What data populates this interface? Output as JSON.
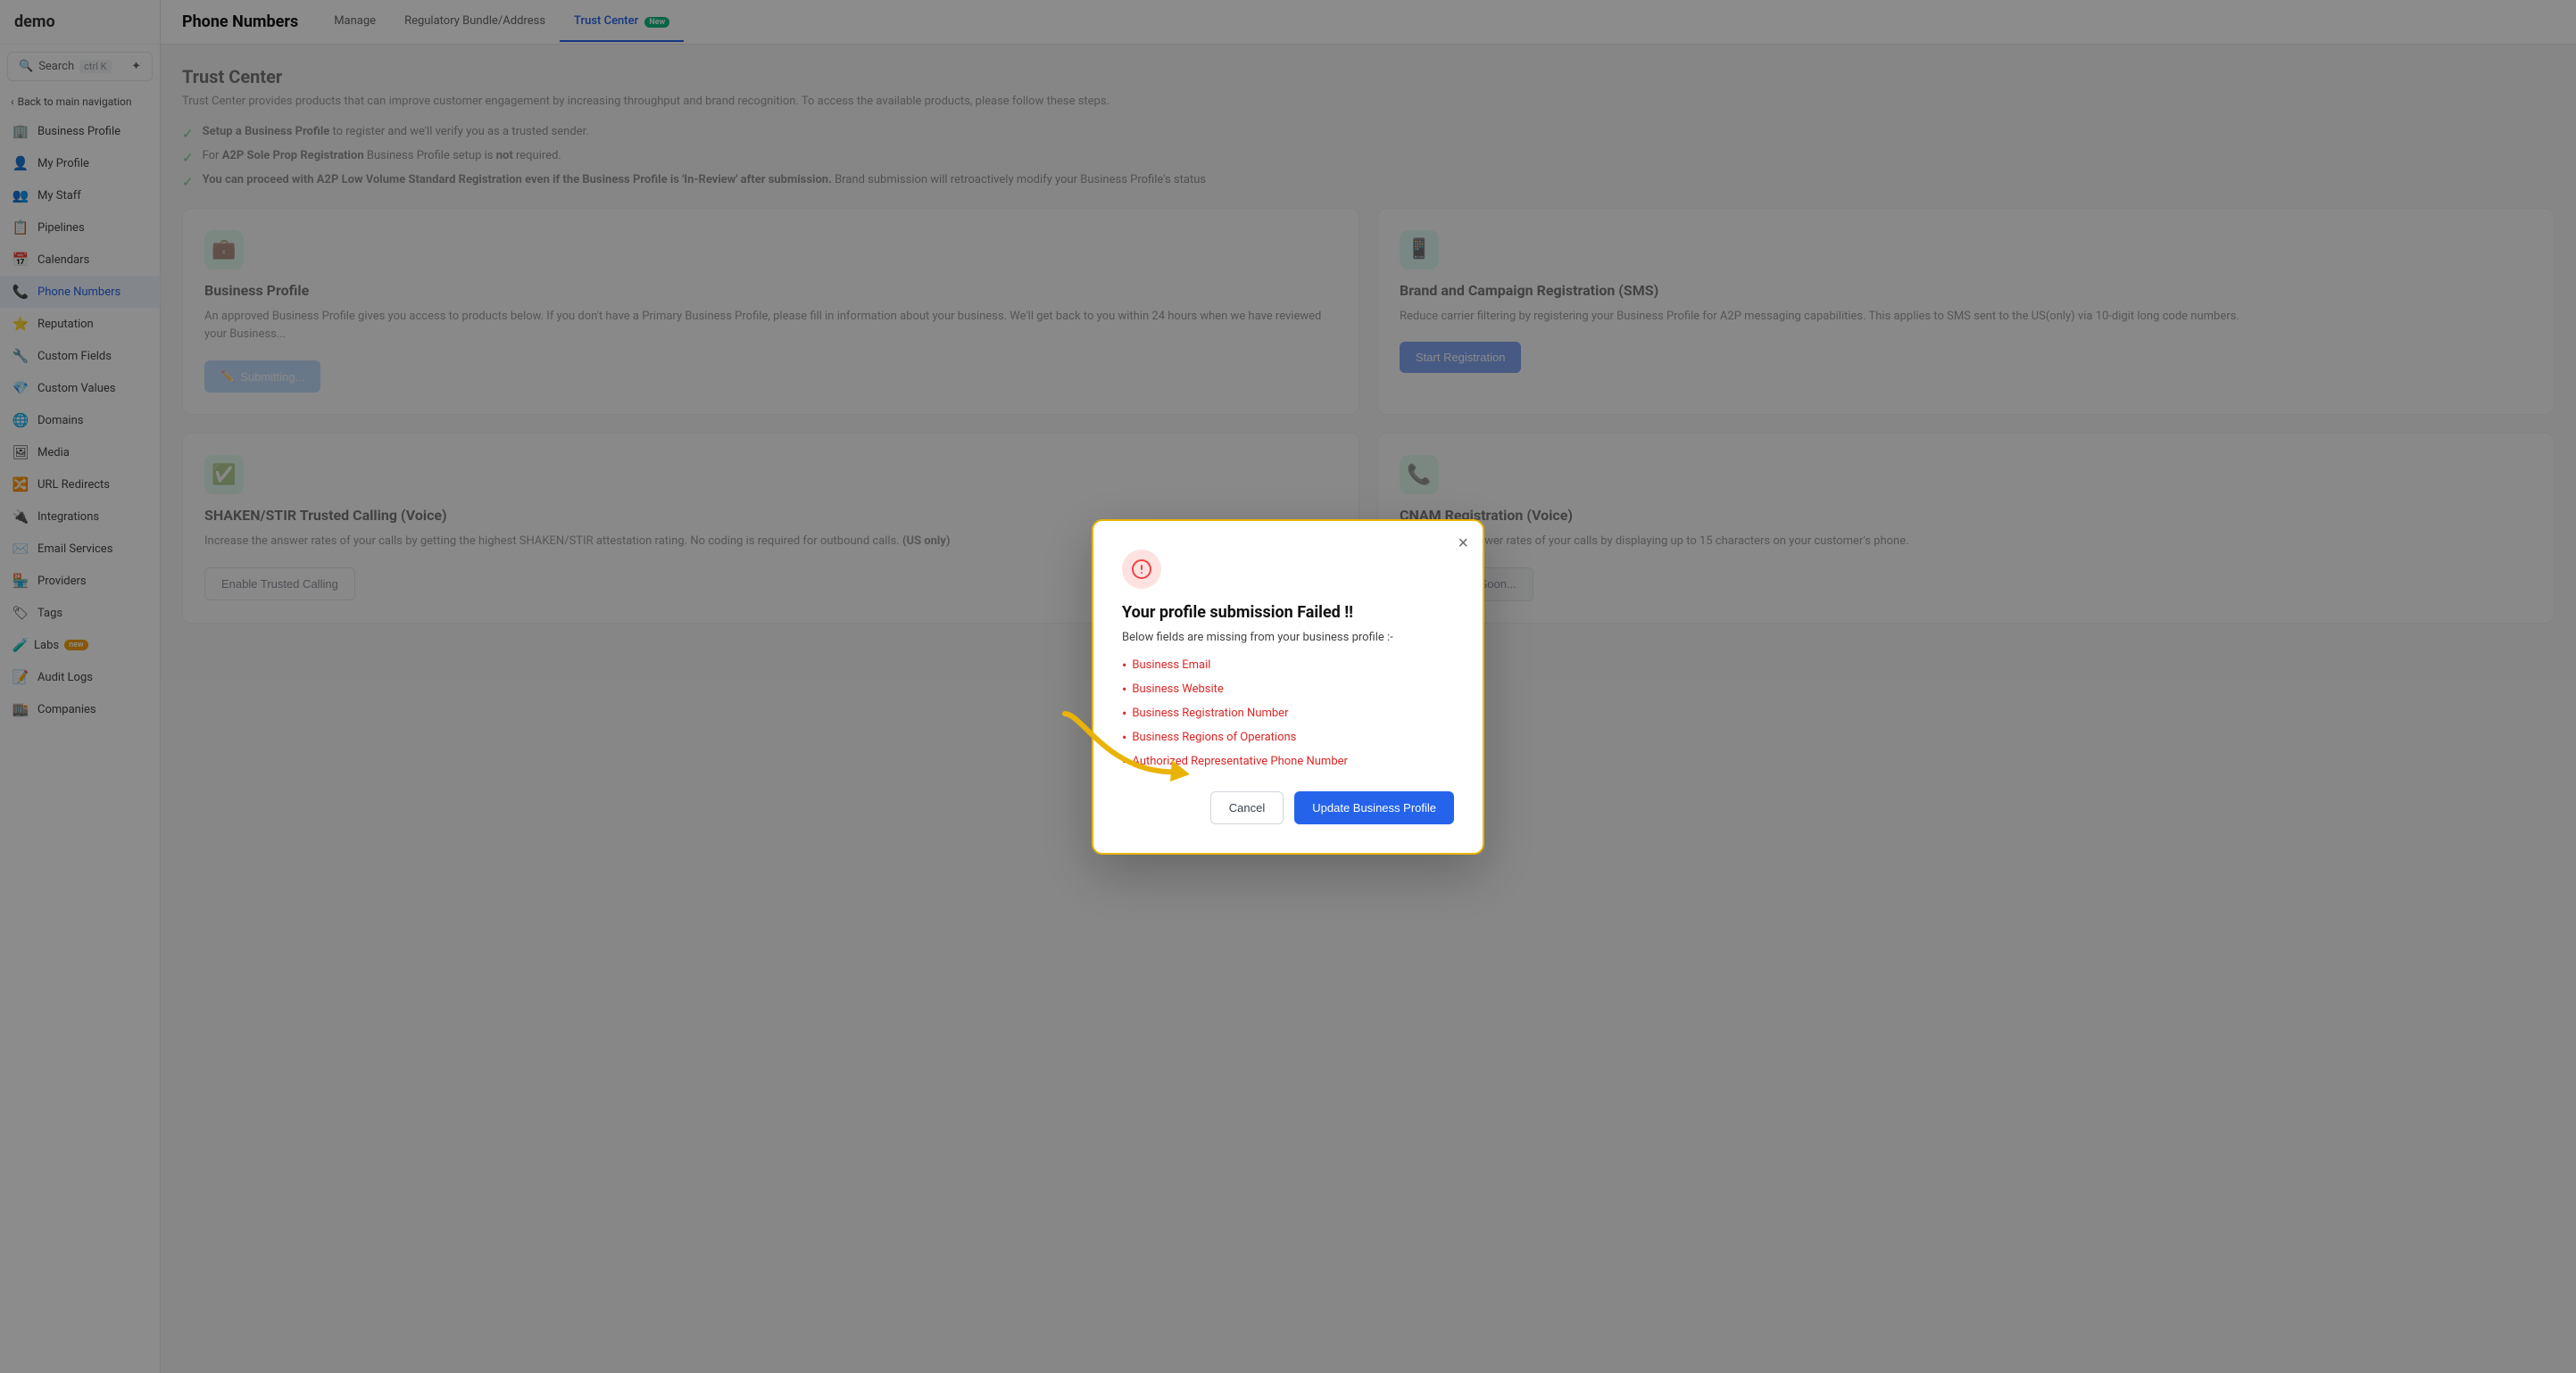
{
  "app": {
    "logo": "demo",
    "search_label": "Search",
    "search_kbd": "ctrl K"
  },
  "sidebar": {
    "back_label": "Back to main navigation",
    "items": [
      {
        "id": "business-profile",
        "label": "Business Profile",
        "icon": "🏢",
        "active": false
      },
      {
        "id": "my-profile",
        "label": "My Profile",
        "icon": "👤",
        "active": false
      },
      {
        "id": "my-staff",
        "label": "My Staff",
        "icon": "👥",
        "active": false
      },
      {
        "id": "pipelines",
        "label": "Pipelines",
        "icon": "📋",
        "active": false
      },
      {
        "id": "calendars",
        "label": "Calendars",
        "icon": "📅",
        "active": false
      },
      {
        "id": "phone-numbers",
        "label": "Phone Numbers",
        "icon": "📞",
        "active": true
      },
      {
        "id": "reputation",
        "label": "Reputation",
        "icon": "⭐",
        "active": false
      },
      {
        "id": "custom-fields",
        "label": "Custom Fields",
        "icon": "🔧",
        "active": false
      },
      {
        "id": "custom-values",
        "label": "Custom Values",
        "icon": "💎",
        "active": false
      },
      {
        "id": "domains",
        "label": "Domains",
        "icon": "🌐",
        "active": false
      },
      {
        "id": "media",
        "label": "Media",
        "icon": "🖼",
        "active": false
      },
      {
        "id": "url-redirects",
        "label": "URL Redirects",
        "icon": "🔀",
        "active": false
      },
      {
        "id": "integrations",
        "label": "Integrations",
        "icon": "🔌",
        "active": false
      },
      {
        "id": "email-services",
        "label": "Email Services",
        "icon": "✉️",
        "active": false
      },
      {
        "id": "providers",
        "label": "Providers",
        "icon": "🏪",
        "active": false
      },
      {
        "id": "tags",
        "label": "Tags",
        "icon": "🏷",
        "active": false
      },
      {
        "id": "labs",
        "label": "Labs",
        "icon": "🧪",
        "active": false,
        "badge": "new"
      },
      {
        "id": "audit-logs",
        "label": "Audit Logs",
        "icon": "📝",
        "active": false
      },
      {
        "id": "companies",
        "label": "Companies",
        "icon": "🏬",
        "active": false
      }
    ]
  },
  "topbar": {
    "title": "Phone Numbers",
    "tabs": [
      {
        "id": "manage",
        "label": "Manage",
        "active": false
      },
      {
        "id": "regulatory",
        "label": "Regulatory Bundle/Address",
        "active": false
      },
      {
        "id": "trust-center",
        "label": "Trust Center",
        "active": true,
        "badge": "New"
      }
    ]
  },
  "trust_center": {
    "title": "Trust Center",
    "description": "Trust Center provides products that can improve customer engagement by increasing throughput and brand recognition. To access the available products, please follow these steps.",
    "checklist": [
      {
        "text_bold": "Setup a Business Profile",
        "text_rest": " to register and we'll verify you as a trusted sender."
      },
      {
        "text_before": "For ",
        "text_bold": "A2P Sole Prop Registration",
        "text_rest": " Business Profile setup is ",
        "text_not": "not",
        "text_end": " required."
      },
      {
        "text_bold": "You can proceed with A2P Low Volume Standard Registration even if the Business Profile is 'In-Review' after submission.",
        "text_rest": " Brand submission will retroactively modify your Business Profile's status"
      }
    ],
    "cards": [
      {
        "id": "business-profile",
        "icon": "💼",
        "icon_style": "green",
        "title": "Business Profile",
        "description": "An approved Business Profile gives you access to products below. If you don't have a Primary Business Profile, please fill in information about your business. We'll get back to you within 24 hours when we have reviewed your Business...",
        "button_label": "Submitting...",
        "button_style": "disabled",
        "button_icon": "✏️"
      },
      {
        "id": "brand-campaign",
        "icon": "📱",
        "icon_style": "teal",
        "title": "Brand and Campaign Registration (SMS)",
        "description": "Reduce carrier filtering by registering your Business Profile for A2P messaging capabilities. This applies to SMS sent to the US(only) via 10-digit long code numbers.",
        "button_label": "Start Registration",
        "button_style": "primary"
      },
      {
        "id": "shaken-stir",
        "icon": "✅",
        "icon_style": "green",
        "title": "SHAKEN/STIR Trusted Calling (Voice)",
        "description": "Increase the answer rates of your calls by getting the highest SHAKEN/STIR attestation rating. No coding is required for outbound calls. (US only)",
        "button_label": "Enable Trusted Calling",
        "button_style": "outline"
      },
      {
        "id": "cnam",
        "icon": "📞",
        "icon_style": "green",
        "title": "CNAM Registration (Voice)",
        "description": "Increase the answer rates of your calls by displaying up to 15 characters on your customer's phone.",
        "button_label": "Coming Soon...",
        "button_style": "secondary",
        "button_icon": "📋"
      }
    ]
  },
  "modal": {
    "title": "Your profile submission Failed !!",
    "subtitle": "Below fields are missing from your business profile :-",
    "missing_fields": [
      "Business Email",
      "Business Website",
      "Business Registration Number",
      "Business Regions of Operations",
      "Authorized Representative Phone Number"
    ],
    "cancel_label": "Cancel",
    "update_label": "Update Business Profile"
  }
}
